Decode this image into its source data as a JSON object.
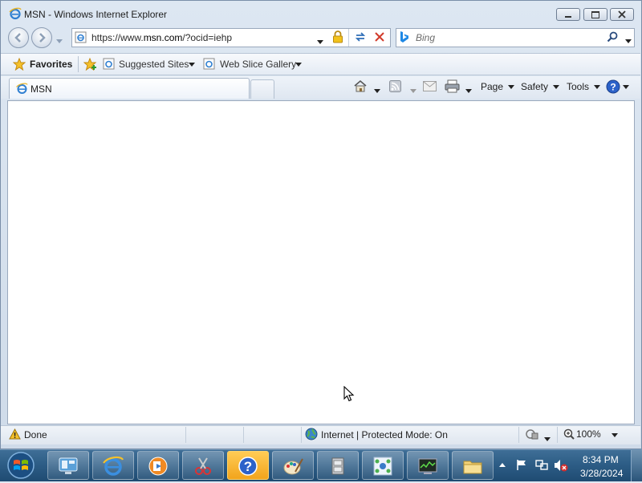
{
  "window": {
    "title": "MSN - Windows Internet Explorer",
    "minimize_icon": "minimize-icon",
    "maximize_icon": "maximize-icon",
    "close_icon": "close-icon"
  },
  "address_bar": {
    "url_prefix": "https://www.",
    "url_domain": "msn.com",
    "url_suffix": "/?ocid=iehp",
    "search_placeholder": "Bing"
  },
  "favorites_bar": {
    "favorites_label": "Favorites",
    "suggested_sites_label": "Suggested Sites",
    "web_slice_gallery_label": "Web Slice Gallery"
  },
  "tabs": [
    {
      "label": "MSN",
      "active": true
    }
  ],
  "command_bar": {
    "page_label": "Page",
    "safety_label": "Safety",
    "tools_label": "Tools"
  },
  "status_bar": {
    "status_text": "Done",
    "zone_text": "Internet | Protected Mode: On",
    "zoom_text": "100%"
  },
  "taskbar": {
    "items": [
      {
        "icon": "server-manager-icon"
      },
      {
        "icon": "internet-explorer-icon"
      },
      {
        "icon": "media-player-icon"
      },
      {
        "icon": "snipping-tool-icon"
      },
      {
        "icon": "help-icon",
        "active": true
      },
      {
        "icon": "paint-icon"
      },
      {
        "icon": "file-cabinet-icon"
      },
      {
        "icon": "network-icon"
      },
      {
        "icon": "performance-monitor-icon"
      },
      {
        "icon": "folder-icon"
      }
    ],
    "time": "8:34 PM",
    "date": "3/28/2024"
  },
  "colors": {
    "taskbar": "#2d5d86",
    "active_taskbar_item": "#f2a41c",
    "content_background": "#ffffff"
  }
}
